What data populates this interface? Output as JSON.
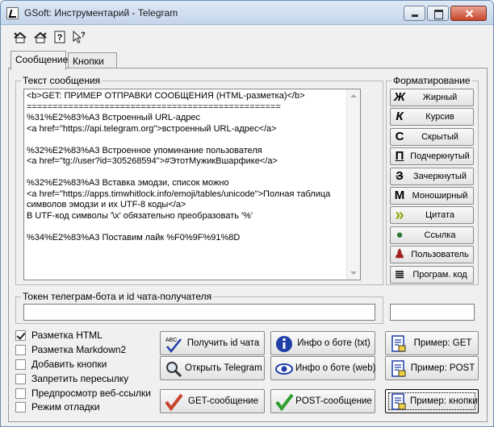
{
  "window": {
    "title": "GSoft: Инструментарий - Telegram"
  },
  "toolbar": {
    "icons": [
      "export-icon",
      "import-icon",
      "help-icon",
      "whats-this-icon"
    ]
  },
  "tabs": [
    {
      "label": "Сообщение",
      "active": true
    },
    {
      "label": "Кнопки",
      "active": false
    }
  ],
  "message": {
    "group_label": "Текст сообщения",
    "text": "<b>GET: ПРИМЕР ОТПРАВКИ СООБЩЕНИЯ (HTML-разметка)</b>\n=================================================\n%31%E2%83%A3 Встроенный URL-адрес\n<a href=\"https://api.telegram.org\">встроенный URL-адрес</a>\n\n%32%E2%83%A3 Встроенное упоминание пользователя\n<a href=\"tg://user?id=305268594\">#ЭтотМужикВшарфике</a>\n\n%32%E2%83%A3 Вставка эмодзи, список можно\n<a href=\"https://apps.timwhitlock.info/emoji/tables/unicode\">Полная таблица символов эмодзи и их UTF-8 коды</a>\nВ UTF-код символы '\\x' обязательно преобразовать '%'\n\n%34%E2%83%A3 Поставим лайк %F0%9F%91%8D"
  },
  "formatting": {
    "group_label": "Форматирование",
    "buttons": [
      {
        "label": "Жирный",
        "glyph": "Ж"
      },
      {
        "label": "Курсив",
        "glyph": "К"
      },
      {
        "label": "Скрытый",
        "glyph": "С"
      },
      {
        "label": "Подчеркнутый",
        "glyph": "П"
      },
      {
        "label": "Зачеркнутый",
        "glyph": "З"
      },
      {
        "label": "Моноширный",
        "glyph": "М"
      },
      {
        "label": "Цитата",
        "glyph": "»"
      },
      {
        "label": "Ссылка",
        "glyph": "●"
      },
      {
        "label": "Пользователь",
        "glyph": "♟"
      },
      {
        "label": "Програм. код",
        "glyph": "≣"
      }
    ]
  },
  "token": {
    "group_label": "Токен телеграм-бота и id чата-получателя",
    "token_value": "",
    "chat_id_value": ""
  },
  "options": [
    {
      "label": "Разметка HTML",
      "checked": true
    },
    {
      "label": "Разметка Markdown2",
      "checked": false
    },
    {
      "label": "Добавить кнопки",
      "checked": false
    },
    {
      "label": "Запретить пересылку",
      "checked": false
    },
    {
      "label": "Предпросмотр веб-ссылки",
      "checked": false
    },
    {
      "label": "Режим отладки",
      "checked": false
    }
  ],
  "actions": {
    "get_chat_id": "Получить id чата",
    "open_telegram": "Открыть Telegram",
    "get_message": "GET-сообщение",
    "bot_info_txt": "Инфо о боте (txt)",
    "bot_info_web": "Инфо о боте (web)",
    "post_message": "POST-сообщение",
    "example_get": "Пример: GET",
    "example_post": "Пример: POST",
    "example_buttons": "Пример: кнопки"
  },
  "colors": {
    "accent_red": "#c8442a",
    "check_green": "#2e9e2e",
    "info_blue": "#1f3fa8"
  }
}
